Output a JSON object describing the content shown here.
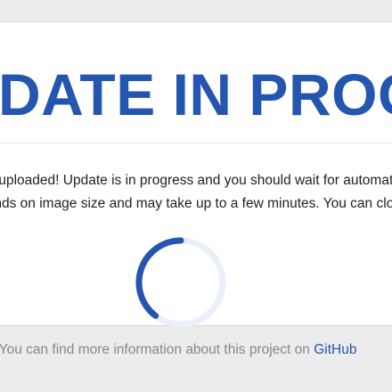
{
  "card": {
    "title": "UPDATE IN PROGRESS",
    "message_line1": "File uploaded! Update is in progress and you should wait for automatic reboot.",
    "message_line2": "This depends on image size and may take up to a few minutes. You can close this page."
  },
  "spinner": {
    "track_color": "#eaf0fb",
    "arc_color": "#2456b0"
  },
  "footer": {
    "text": "You can find more information about this project on ",
    "link_label": "GitHub"
  }
}
